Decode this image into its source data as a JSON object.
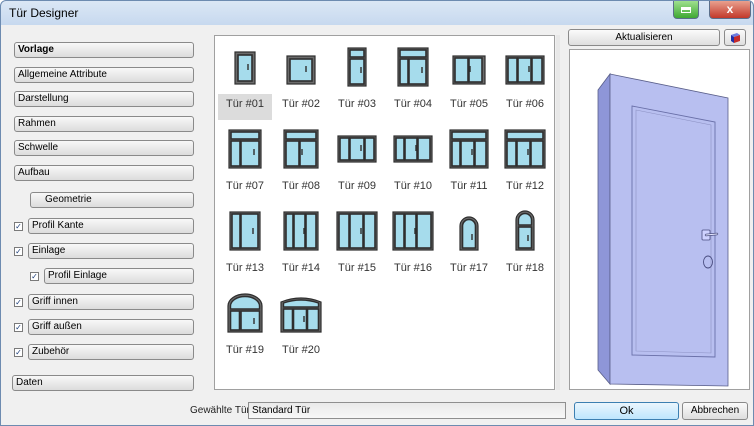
{
  "window": {
    "title": "Tür Designer",
    "close_label": "x"
  },
  "nav": {
    "vorlage": "Vorlage",
    "allgemeine": "Allgemeine Attribute",
    "darstellung": "Darstellung",
    "rahmen": "Rahmen",
    "schwelle": "Schwelle",
    "aufbau": "Aufbau",
    "geometrie": "Geometrie",
    "profil_kante": "Profil Kante",
    "einlage": "Einlage",
    "profil_einlage": "Profil Einlage",
    "griff_innen": "Griff innen",
    "griff_aussen": "Griff außen",
    "zubehoer": "Zubehör",
    "daten": "Daten",
    "check_mark": "✓"
  },
  "gallery": {
    "selected": "Tür #01",
    "items": [
      "Tür #01",
      "Tür #02",
      "Tür #03",
      "Tür #04",
      "Tür #05",
      "Tür #06",
      "Tür #07",
      "Tür #08",
      "Tür #09",
      "Tür #10",
      "Tür #11",
      "Tür #12",
      "Tür #13",
      "Tür #14",
      "Tür #15",
      "Tür #16",
      "Tür #17",
      "Tür #18",
      "Tür #19",
      "Tür #20"
    ]
  },
  "preview": {
    "refresh_label": "Aktualisieren"
  },
  "footer": {
    "selected_label": "Gewählte Tür",
    "selected_value": "Standard Tür",
    "ok_label": "Ok",
    "cancel_label": "Abbrechen"
  },
  "colors": {
    "glass": "#a6dcec",
    "frame": "#2e2e2e",
    "door_face": "#b8bff0",
    "door_side": "#8e96d8"
  }
}
